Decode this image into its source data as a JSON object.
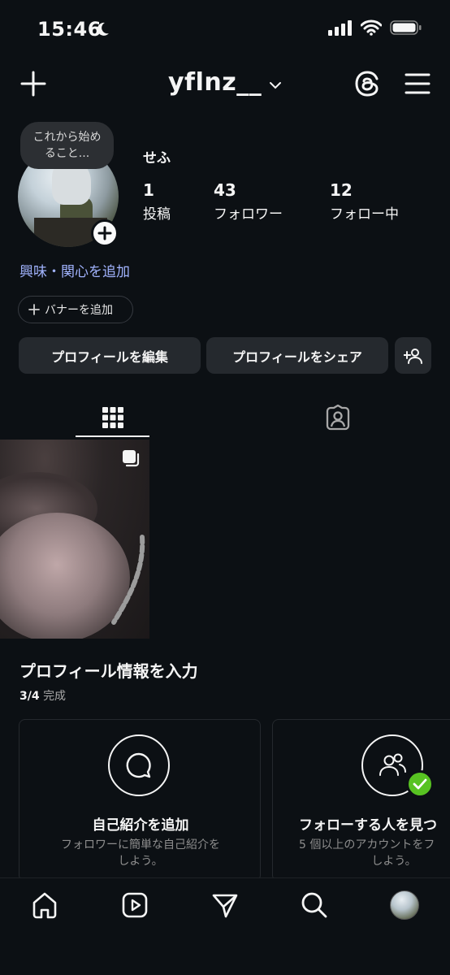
{
  "status_bar": {
    "time": "15:46"
  },
  "header": {
    "username": "yflnz__"
  },
  "profile": {
    "note_bubble": [
      "これから始め",
      "ること..."
    ],
    "name": "せふ",
    "stats": [
      {
        "number": "1",
        "label": "投稿"
      },
      {
        "number": "43",
        "label": "フォロワー"
      },
      {
        "number": "12",
        "label": "フォロー中"
      }
    ],
    "interests_link": "興味・関心を追加",
    "banner_button": "バナーを追加"
  },
  "actions": {
    "edit_profile": "プロフィールを編集",
    "share_profile": "プロフィールをシェア"
  },
  "tabs": [
    "grid",
    "tagged"
  ],
  "completion": {
    "title": "プロフィール情報を入力",
    "progress": "3/4",
    "progress_suffix": "完成",
    "cards": [
      {
        "icon": "speech-bubble-icon",
        "title": "自己紹介を追加",
        "desc_lines": [
          "フォロワーに簡単な自己紹介を",
          "しよう。"
        ],
        "done": false
      },
      {
        "icon": "people-icon",
        "title": "フォローする人を見つ",
        "desc_lines": [
          "5 個以上のアカウントをフ",
          "しよう。"
        ],
        "done": true
      }
    ]
  },
  "bottom_nav": [
    "home-icon",
    "reels-icon",
    "messages-icon",
    "search-icon",
    "profile-avatar"
  ],
  "colors": {
    "background": "#0c1014",
    "link": "#a2b4ff",
    "button": "#25292e",
    "check": "#58c322"
  }
}
